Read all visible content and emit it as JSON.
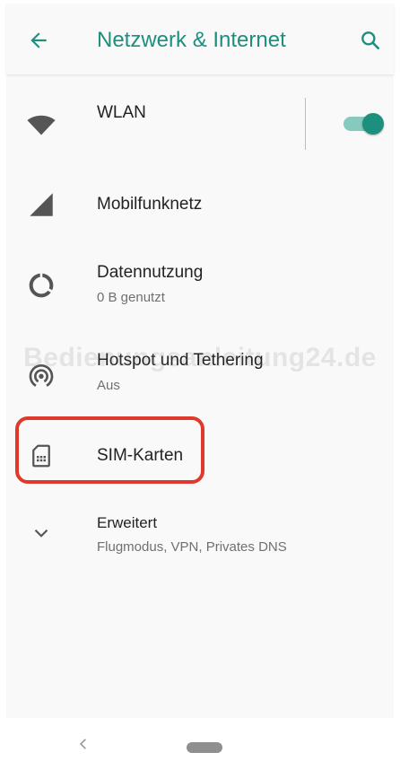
{
  "appbar": {
    "title": "Netzwerk & Internet",
    "back_icon": "arrow-left-icon",
    "search_icon": "search-icon"
  },
  "items": [
    {
      "label": "WLAN",
      "icon": "wifi-icon",
      "toggle": true
    },
    {
      "label": "Mobilfunknetz",
      "icon": "cellular-signal-icon"
    },
    {
      "label": "Datennutzung",
      "summary": "0 B genutzt",
      "icon": "data-usage-icon"
    },
    {
      "label": "Hotspot und Tethering",
      "summary": "Aus",
      "icon": "hotspot-icon"
    },
    {
      "label": "SIM-Karten",
      "icon": "sim-card-icon",
      "highlighted": true
    },
    {
      "label": "Erweitert",
      "summary": "Flugmodus, VPN, Privates DNS",
      "icon": "chevron-down-icon"
    }
  ],
  "watermark": "Bedienungsanleitung24.de",
  "navbar": {
    "back_icon": "nav-back-icon",
    "home_icon": "home-pill-icon"
  },
  "colors": {
    "accent": "#1c8f7e",
    "toggle_track": "#86c9bd",
    "highlight": "#e0392b",
    "icon": "#555555"
  }
}
